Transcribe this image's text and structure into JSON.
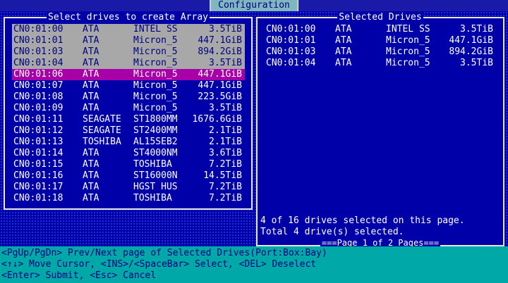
{
  "window": {
    "title": "Configuration"
  },
  "available": {
    "title": "Select drives to create Array",
    "drives": [
      {
        "port": "CN0:01:00",
        "iface": "ATA",
        "model": "INTEL SS",
        "size": "3.5TiB",
        "state": "selected"
      },
      {
        "port": "CN0:01:01",
        "iface": "ATA",
        "model": "Micron_5",
        "size": "447.1GiB",
        "state": "selected"
      },
      {
        "port": "CN0:01:03",
        "iface": "ATA",
        "model": "Micron_5",
        "size": "894.2GiB",
        "state": "selected"
      },
      {
        "port": "CN0:01:04",
        "iface": "ATA",
        "model": "Micron_5",
        "size": "3.5TiB",
        "state": "selected"
      },
      {
        "port": "CN0:01:06",
        "iface": "ATA",
        "model": "Micron_5",
        "size": "447.1GiB",
        "state": "cursor"
      },
      {
        "port": "CN0:01:07",
        "iface": "ATA",
        "model": "Micron_5",
        "size": "447.1GiB",
        "state": "normal"
      },
      {
        "port": "CN0:01:08",
        "iface": "ATA",
        "model": "Micron_5",
        "size": "223.5GiB",
        "state": "normal"
      },
      {
        "port": "CN0:01:09",
        "iface": "ATA",
        "model": "Micron_5",
        "size": "3.5TiB",
        "state": "normal"
      },
      {
        "port": "CN0:01:11",
        "iface": "SEAGATE",
        "model": "ST1800MM",
        "size": "1676.6GiB",
        "state": "normal"
      },
      {
        "port": "CN0:01:12",
        "iface": "SEAGATE",
        "model": "ST2400MM",
        "size": "2.1TiB",
        "state": "normal"
      },
      {
        "port": "CN0:01:13",
        "iface": "TOSHIBA",
        "model": "AL15SEB2",
        "size": "2.1TiB",
        "state": "normal"
      },
      {
        "port": "CN0:01:14",
        "iface": "ATA",
        "model": "ST4000NM",
        "size": "3.6TiB",
        "state": "normal"
      },
      {
        "port": "CN0:01:15",
        "iface": "ATA",
        "model": "TOSHIBA",
        "size": "7.2TiB",
        "state": "normal"
      },
      {
        "port": "CN0:01:16",
        "iface": "ATA",
        "model": "ST16000N",
        "size": "14.5TiB",
        "state": "normal"
      },
      {
        "port": "CN0:01:17",
        "iface": "ATA",
        "model": "HGST HUS",
        "size": "7.2TiB",
        "state": "normal"
      },
      {
        "port": "CN0:01:18",
        "iface": "ATA",
        "model": "TOSHIBA",
        "size": "7.2TiB",
        "state": "normal"
      }
    ]
  },
  "selected": {
    "title": "Selected Drives",
    "drives": [
      {
        "port": "CN0:01:00",
        "iface": "ATA",
        "model": "INTEL SS",
        "size": "3.5TiB"
      },
      {
        "port": "CN0:01:01",
        "iface": "ATA",
        "model": "Micron_5",
        "size": "447.1GiB"
      },
      {
        "port": "CN0:01:03",
        "iface": "ATA",
        "model": "Micron_5",
        "size": "894.2GiB"
      },
      {
        "port": "CN0:01:04",
        "iface": "ATA",
        "model": "Micron_5",
        "size": "3.5TiB"
      }
    ],
    "status_line1": "4 of 16 drives selected on this page.",
    "status_line2": "Total 4 drive(s) selected.",
    "pager": "===Page 1 of 2 Pages==="
  },
  "help": {
    "line1": "<PgUp/PgDn> Prev/Next page of Selected Drives(Port:Box:Bay)",
    "line2": "<↑↓> Move Cursor, <INS>/<SpaceBar> Select, <DEL> Deselect",
    "line3": "<Enter> Submit, <Esc> Cancel"
  },
  "colors": {
    "background": "#0000a8",
    "selected_row": "#a8a8a8",
    "cursor_row": "#a800a8",
    "help_bar": "#00a8a8",
    "title_bar": "#7fb6bf"
  }
}
